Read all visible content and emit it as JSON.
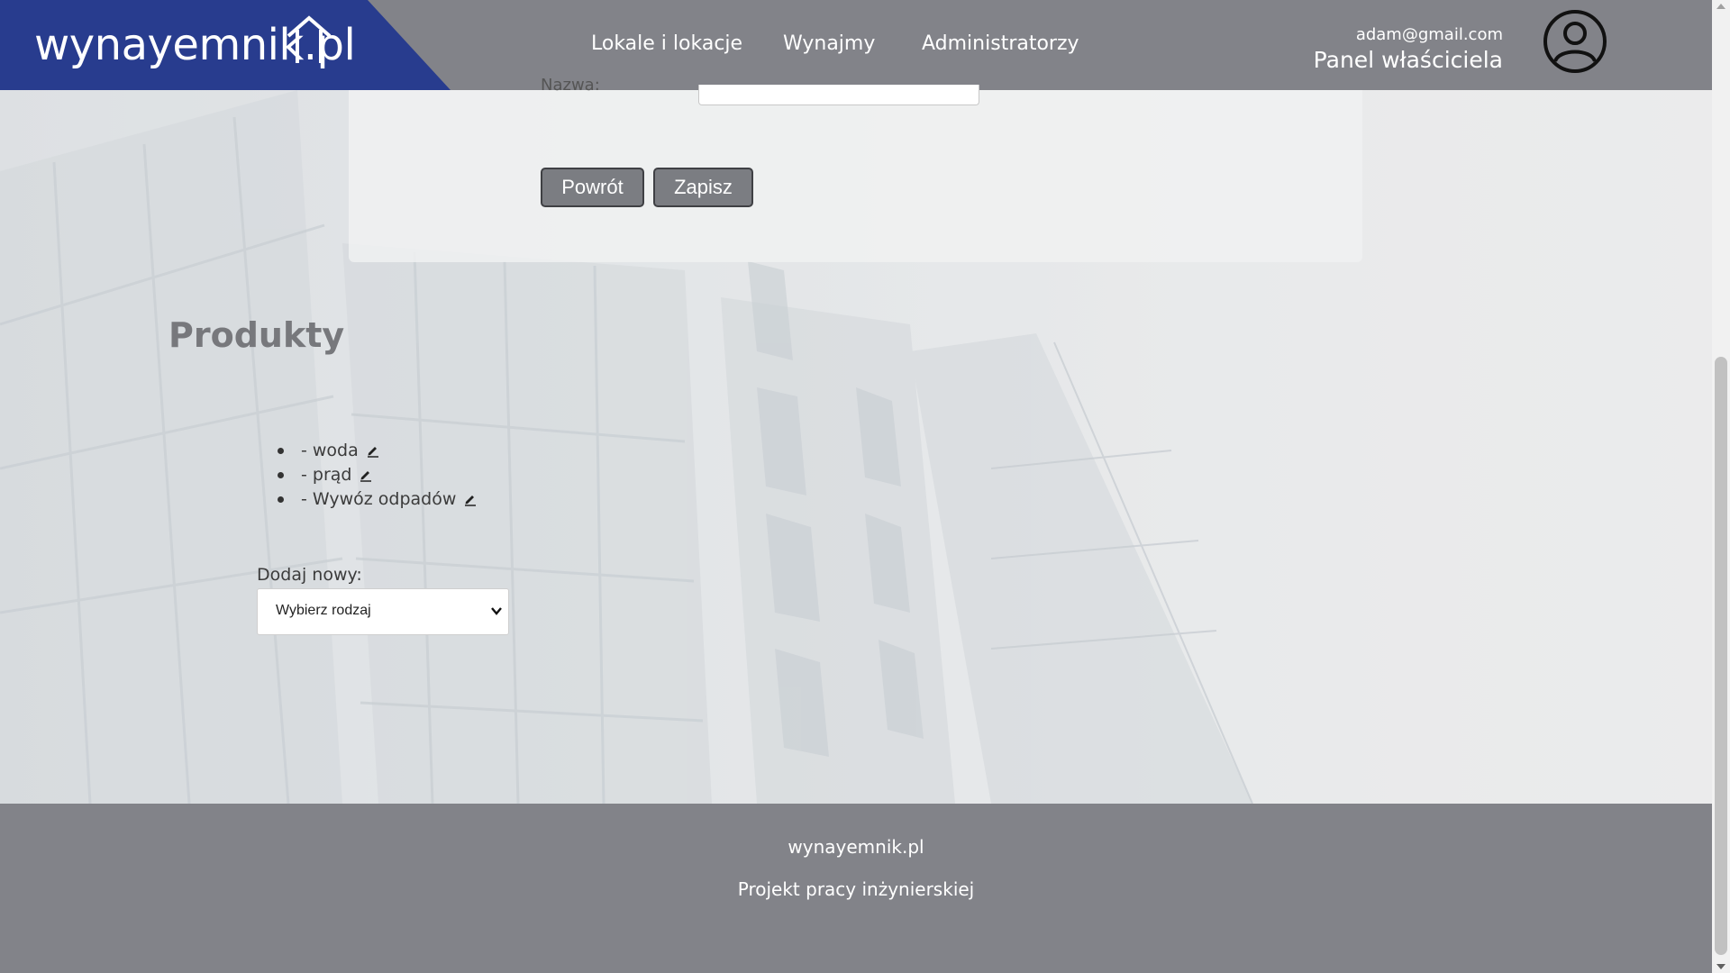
{
  "header": {
    "logo_text": "wynayemnik.pl",
    "nav": [
      {
        "label": "Lokale i lokacje"
      },
      {
        "label": "Wynajmy"
      },
      {
        "label": "Administratorzy"
      }
    ],
    "user_email": "adam@gmail.com",
    "panel_label": "Panel właściciela"
  },
  "form": {
    "field_label_partial": "Nazwa:",
    "back_label": "Powrót",
    "save_label": "Zapisz"
  },
  "products": {
    "title": "Produkty",
    "items": [
      {
        "label": "- woda"
      },
      {
        "label": "- prąd"
      },
      {
        "label": "- Wywóz odpadów"
      }
    ],
    "add_label": "Dodaj nowy:",
    "select_value": "Wybierz rodzaj"
  },
  "footer": {
    "site": "wynayemnik.pl",
    "project": "Projekt pracy inżynierskiej"
  },
  "colors": {
    "header_bg": "#828389",
    "logo_bg": "#283c8e",
    "button_bg": "#7b7d82",
    "footer_bg": "#828389"
  },
  "icons": [
    "house-logo-icon",
    "user-avatar-icon",
    "edit-pencil-icon",
    "chevron-down-icon"
  ]
}
